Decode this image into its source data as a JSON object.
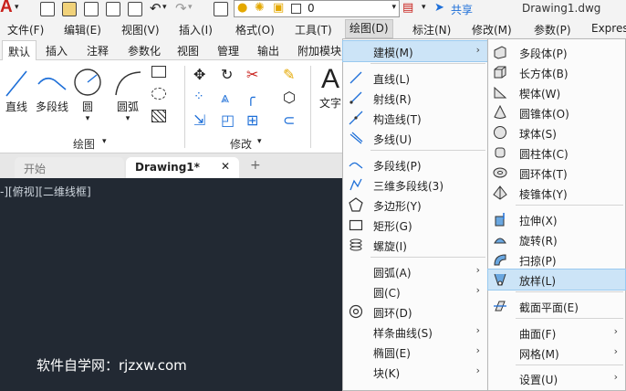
{
  "qat": {
    "layer_value": "0",
    "share_label": "共享",
    "window_title": "Drawing1.dwg"
  },
  "menubar": {
    "items": [
      "文件(F)",
      "编辑(E)",
      "视图(V)",
      "插入(I)",
      "格式(O)",
      "工具(T)",
      "绘图(D)",
      "标注(N)",
      "修改(M)",
      "参数(P)",
      "Expres"
    ],
    "active": "绘图(D)"
  },
  "ribbon_tabs": {
    "items": [
      "默认",
      "插入",
      "注释",
      "参数化",
      "视图",
      "管理",
      "输出",
      "附加模块"
    ],
    "active": "默认"
  },
  "ribbon": {
    "draw_tools": [
      "直线",
      "多段线",
      "圆",
      "圆弧"
    ],
    "draw_panel_label": "绘图",
    "modify_panel_label": "修改",
    "text_tool": "文字"
  },
  "doc_tabs": {
    "start": "开始",
    "drawing": "Drawing1*",
    "close_glyph": "✕",
    "add_glyph": "+"
  },
  "canvas": {
    "view_label": "-][俯视][二维线框]",
    "watermark": "软件自学网：rjzxw.com"
  },
  "draw_menu": {
    "items": [
      {
        "label": "建模(M)",
        "submenu": true,
        "highlighted": true
      },
      {
        "label": "直线(L)"
      },
      {
        "label": "射线(R)"
      },
      {
        "label": "构造线(T)"
      },
      {
        "label": "多线(U)"
      },
      {
        "label": "多段线(P)"
      },
      {
        "label": "三维多段线(3)"
      },
      {
        "label": "多边形(Y)"
      },
      {
        "label": "矩形(G)"
      },
      {
        "label": "螺旋(I)"
      },
      {
        "label": "圆弧(A)",
        "submenu": true
      },
      {
        "label": "圆(C)",
        "submenu": true
      },
      {
        "label": "圆环(D)"
      },
      {
        "label": "样条曲线(S)",
        "submenu": true
      },
      {
        "label": "椭圆(E)",
        "submenu": true
      },
      {
        "label": "块(K)",
        "submenu": true
      }
    ]
  },
  "modeling_menu": {
    "items": [
      {
        "label": "多段体(P)"
      },
      {
        "label": "长方体(B)"
      },
      {
        "label": "楔体(W)"
      },
      {
        "label": "圆锥体(O)"
      },
      {
        "label": "球体(S)"
      },
      {
        "label": "圆柱体(C)"
      },
      {
        "label": "圆环体(T)"
      },
      {
        "label": "棱锥体(Y)"
      },
      {
        "label": "拉伸(X)"
      },
      {
        "label": "旋转(R)"
      },
      {
        "label": "扫掠(P)"
      },
      {
        "label": "放样(L)",
        "highlighted": true
      },
      {
        "label": "截面平面(E)"
      },
      {
        "label": "曲面(F)",
        "submenu": true
      },
      {
        "label": "网格(M)",
        "submenu": true
      },
      {
        "label": "设置(U)",
        "submenu": true
      }
    ]
  },
  "colors": {
    "highlight": "#cce4f7",
    "canvas": "#222933",
    "accent_blue": "#1e6fd8",
    "logo_red": "#c8201b"
  }
}
